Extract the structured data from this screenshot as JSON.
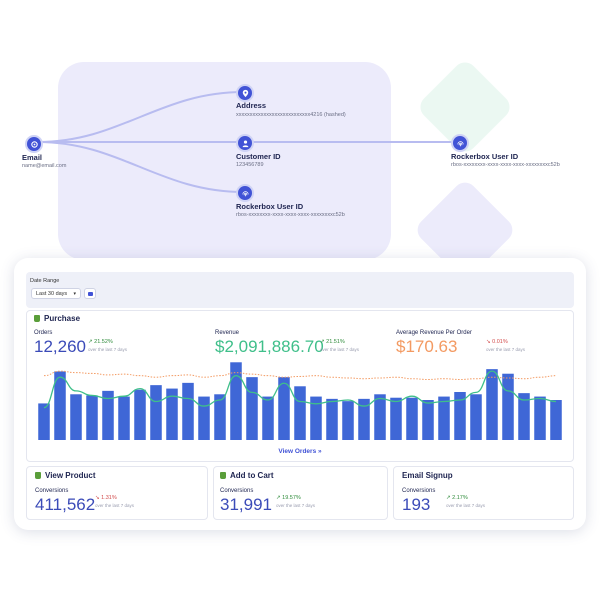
{
  "identity_graph": {
    "email": {
      "label": "Email",
      "value": "name@email.com"
    },
    "address": {
      "label": "Address",
      "value": "xxxxxxxxxxxxxxxxxxxxxxxxxxx4216 (hashed)"
    },
    "customer_id": {
      "label": "Customer ID",
      "value": "123456789"
    },
    "rockerbox_mid": {
      "label": "Rockerbox User ID",
      "value": "rbos-xxxxxxxx-xxxx-xxxx-xxxx-xxxxxxxxc52b"
    },
    "rockerbox_right": {
      "label": "Rockerbox User ID",
      "value": "rbos-xxxxxxxx-xxxx-xxxx-xxxx-xxxxxxxxc52b"
    }
  },
  "filters": {
    "date_range_label": "Date Range",
    "date_range_value": "Last 30 days"
  },
  "purchase": {
    "title": "Purchase",
    "orders": {
      "label": "Orders",
      "value": "12,260",
      "delta": "21.52%",
      "note": "over the last 7 days"
    },
    "revenue": {
      "label": "Revenue",
      "value": "$2,091,886.70",
      "delta": "21.51%",
      "note": "over the last 7 days"
    },
    "aov": {
      "label": "Average Revenue Per Order",
      "value": "$170.63",
      "delta": "0.01%",
      "note": "over the last 7 days"
    },
    "view_link": "View Orders »"
  },
  "cards": [
    {
      "title": "View Product",
      "label": "Conversions",
      "value": "411,562",
      "delta": "1.31%",
      "direction": "down",
      "note": "over the last 7 days"
    },
    {
      "title": "Add to Cart",
      "label": "Conversions",
      "value": "31,991",
      "delta": "19.57%",
      "direction": "up",
      "note": "over the last 7 days"
    },
    {
      "title": "Email Signup",
      "label": "Conversions",
      "value": "193",
      "delta": "2.17%",
      "direction": "up",
      "note": "over the last 7 days"
    }
  ],
  "colors": {
    "accent": "#4153d6",
    "orders_value": "#3b4bb8",
    "revenue_value": "#3fbf8a",
    "aov_value": "#f39a62",
    "bar": "#3f67d6",
    "line_green": "#3fbf8a",
    "line_orange": "#f39a62"
  },
  "chart_data": {
    "type": "bar",
    "bars": [
      32,
      60,
      40,
      39,
      43,
      38,
      44,
      48,
      45,
      50,
      38,
      40,
      68,
      55,
      38,
      55,
      47,
      38,
      36,
      34,
      36,
      40,
      37,
      37,
      35,
      38,
      42,
      40,
      62,
      58,
      41,
      38,
      35
    ],
    "green_line": [
      0.4,
      0.8,
      0.62,
      0.56,
      0.52,
      0.55,
      0.65,
      0.48,
      0.55,
      0.52,
      0.42,
      0.5,
      0.82,
      0.6,
      0.5,
      0.72,
      0.48,
      0.45,
      0.48,
      0.5,
      0.42,
      0.52,
      0.48,
      0.55,
      0.46,
      0.48,
      0.5,
      0.6,
      0.88,
      0.62,
      0.5,
      0.52,
      0.48
    ],
    "orange_line": [
      0.82,
      0.88,
      0.86,
      0.85,
      0.83,
      0.84,
      0.82,
      0.8,
      0.82,
      0.83,
      0.8,
      0.82,
      0.86,
      0.84,
      0.82,
      0.8,
      0.81,
      0.82,
      0.8,
      0.79,
      0.78,
      0.79,
      0.8,
      0.78,
      0.77,
      0.78,
      0.77,
      0.78,
      0.8,
      0.79,
      0.78,
      0.8,
      0.82
    ]
  }
}
